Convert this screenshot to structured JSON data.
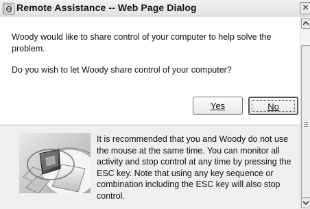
{
  "window": {
    "title": "Remote Assistance -- Web Page Dialog",
    "close_glyph": "✕"
  },
  "dialog": {
    "message": "Woody would like to share control of your computer to help solve the problem.",
    "question": "Do you wish to let Woody share control of your computer?",
    "yes_label": "Yes",
    "no_label": "No",
    "info_text": "It is recommended that you and Woody  do not use the mouse at the same time. You can monitor all activity and stop control at any time by pressing the ESC key. Note that using any key sequence or combination including the ESC key will also stop control."
  },
  "icons": {
    "window_icon": "ie-page-icon",
    "illustration": "mouse-and-keyboard-image",
    "scroll_up": "chevron-up-icon",
    "scroll_down": "chevron-down-icon"
  }
}
